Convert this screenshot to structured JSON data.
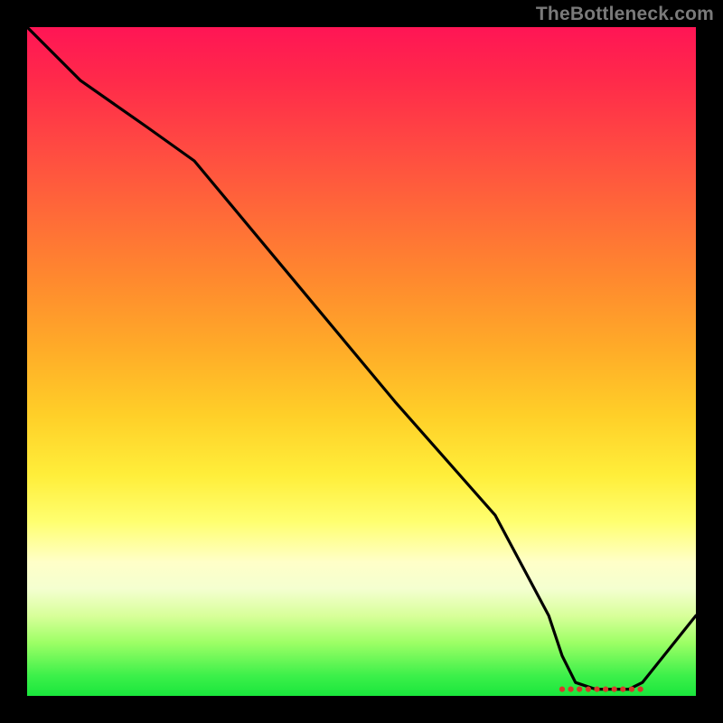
{
  "watermark": "TheBottleneck.com",
  "chart_data": {
    "type": "line",
    "title": "",
    "xlabel": "",
    "ylabel": "",
    "xlim": [
      0,
      100
    ],
    "ylim": [
      0,
      100
    ],
    "x": [
      0,
      8,
      18,
      25,
      40,
      55,
      70,
      78,
      80,
      82,
      85,
      88,
      90,
      92,
      100
    ],
    "values": [
      100,
      92,
      85,
      80,
      62,
      44,
      27,
      12,
      6,
      2,
      1,
      1,
      1,
      2,
      12
    ],
    "note": "Single curve over a vertical heat gradient. Curve descends from top-left, steepens after x≈25, bottoms out near x≈82–90 (marked by small red dots), then rises toward the right edge.",
    "bottom_marker_range": {
      "x_start": 80,
      "x_end": 92,
      "y": 1,
      "color": "#d63a2a"
    }
  }
}
